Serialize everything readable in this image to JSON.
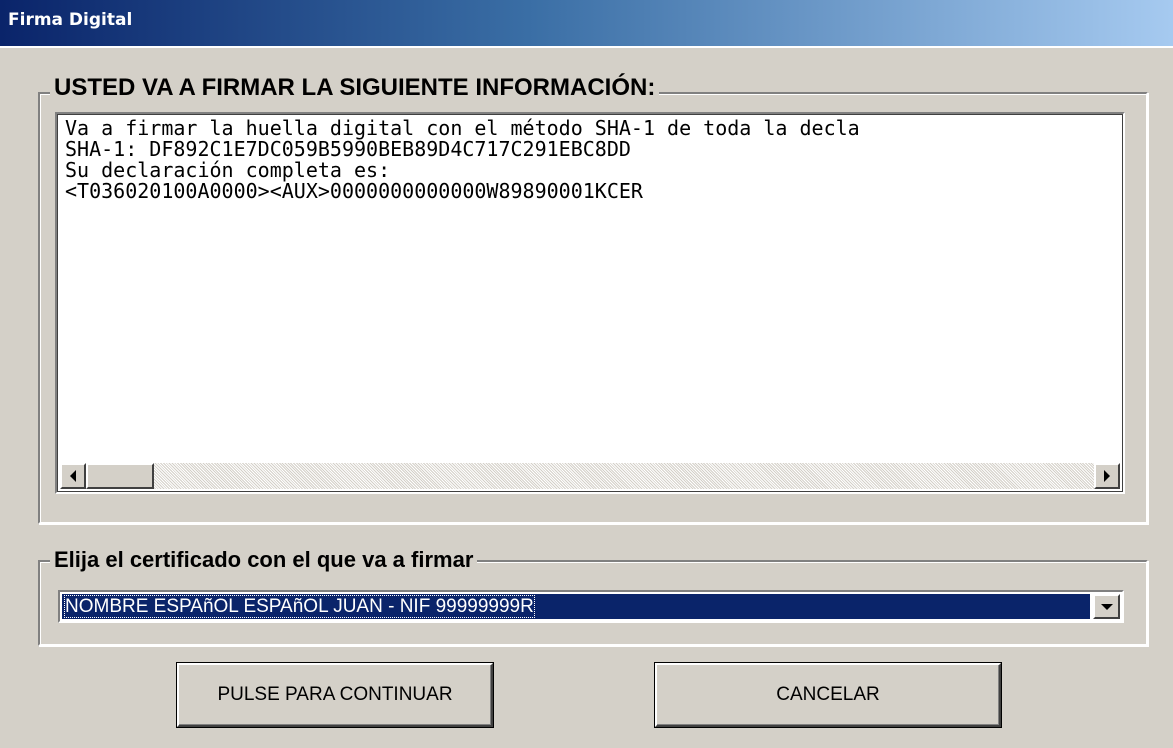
{
  "window": {
    "title": "Firma Digital"
  },
  "info_group": {
    "legend": "USTED VA A FIRMAR LA SIGUIENTE INFORMACIÓN:",
    "text": "Va a firmar la huella digital con el método SHA-1 de toda la decla\nSHA-1: DF892C1E7DC059B5990BEB89D4C717C291EBC8DD\nSu declaración completa es:\n<T036020100A0000><AUX>0000000000000W89890001KCER"
  },
  "certificate_group": {
    "legend": "Elija el certificado con el que va a firmar",
    "selected": "NOMBRE ESPAñOL ESPAñOL JUAN - NIF 99999999R"
  },
  "buttons": {
    "continue_label": "PULSE PARA CONTINUAR",
    "cancel_label": "CANCELAR"
  },
  "icons": {
    "scroll_left": "arrow-left-icon",
    "scroll_right": "arrow-right-icon",
    "dropdown": "chevron-down-icon"
  },
  "colors": {
    "titlebar_start": "#0a246a",
    "titlebar_end": "#a6caf0",
    "window_bg": "#d4d0c8",
    "selection_bg": "#0a246a"
  }
}
